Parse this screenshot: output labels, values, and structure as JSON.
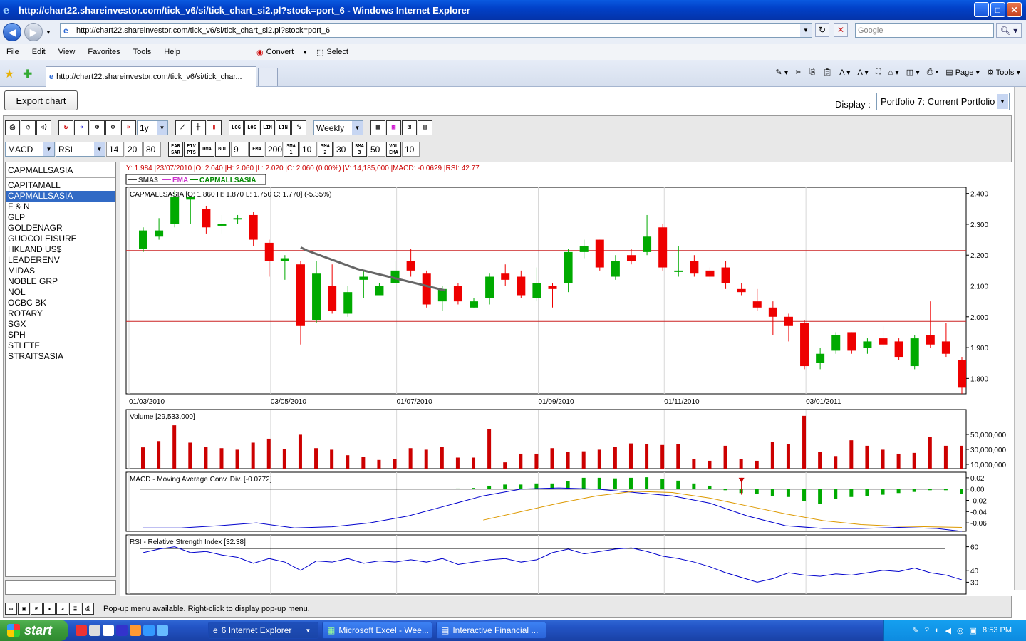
{
  "window": {
    "title": "http://chart22.shareinvestor.com/tick_v6/si/tick_chart_si2.pl?stock=port_6 - Windows Internet Explorer",
    "min": "_",
    "max": "□",
    "close": "✕"
  },
  "address": {
    "url": "http://chart22.shareinvestor.com/tick_v6/si/tick_chart_si2.pl?stock=port_6",
    "search_placeholder": "Google"
  },
  "menu": [
    "File",
    "Edit",
    "View",
    "Favorites",
    "Tools",
    "Help"
  ],
  "toolbar": {
    "convert": "Convert",
    "select": "Select",
    "page": "Page",
    "tools": "Tools"
  },
  "tab": {
    "label": "http://chart22.shareinvestor.com/tick_v6/si/tick_char..."
  },
  "page": {
    "export_label": "Export chart",
    "display_label": "Display :",
    "display_value": "Portfolio 7: Current Portfolio"
  },
  "applet": {
    "period": "1y",
    "interval": "Weekly",
    "ind1": "MACD",
    "ind2": "RSI",
    "row2": {
      "n1": "14",
      "n2": "20",
      "n3": "80",
      "bol": "9",
      "ema": "200",
      "sma1": "10",
      "sma2": "30",
      "sma3": "50",
      "vol": "10"
    },
    "stock_header": "CAPMALLSASIA",
    "stocks": [
      "CAPITAMALL",
      "CAPMALLSASIA",
      "F & N",
      "GLP",
      "GOLDENAGR",
      "GUOCOLEISURE",
      "HKLAND US$",
      "LEADERENV",
      "MIDAS",
      "NOBLE GRP",
      "NOL",
      "OCBC BK",
      "ROTARY",
      "SGX",
      "SPH",
      "STI ETF",
      "STRAITSASIA"
    ],
    "selected_index": 1,
    "status": "Pop-up menu available. Right-click to display pop-up menu."
  },
  "chart_data": {
    "type": "candlestick",
    "info_line": "Y: 1.984 |23/07/2010 |O: 2.040 |H: 2.060 |L: 2.020 |C: 2.060 (0.00%) |V: 14,185,000 |MACD: -0.0629 |RSI: 42.77",
    "legend": [
      "SMA3",
      "EMA",
      "CAPMALLSASIA"
    ],
    "price_label": "CAPMALLSASIA [O: 1.860  H: 1.870  L: 1.750  C: 1.770] (-5.35%)",
    "volume_label": "Volume [29,533,000]",
    "macd_label": "MACD - Moving Average Conv. Div. [-0.0772]",
    "rsi_label": "RSI - Relative Strength Index [32.38]",
    "x_labels": [
      "01/03/2010",
      "03/05/2010",
      "01/07/2010",
      "01/09/2010",
      "01/11/2010",
      "03/01/2011"
    ],
    "ylim": [
      1.75,
      2.42
    ],
    "y_ticks": [
      "2.400",
      "2.300",
      "2.200",
      "2.100",
      "2.000",
      "1.900",
      "1.800"
    ],
    "hlines": [
      2.215,
      1.985
    ],
    "vol_ticks": [
      "50,000,000",
      "30,000,000",
      "10,000,000"
    ],
    "macd_ticks": [
      "0.02",
      "0.00",
      "-0.02",
      "-0.04",
      "-0.06"
    ],
    "rsi_ticks": [
      "60",
      "40",
      "30"
    ],
    "ohlc": [
      [
        2.22,
        2.28,
        2.21,
        2.29
      ],
      [
        2.26,
        2.28,
        2.25,
        2.32
      ],
      [
        2.3,
        2.39,
        2.29,
        2.41
      ],
      [
        2.38,
        2.39,
        2.3,
        2.39
      ],
      [
        2.35,
        2.29,
        2.27,
        2.36
      ],
      [
        2.3,
        2.3,
        2.27,
        2.33
      ],
      [
        2.32,
        2.32,
        2.3,
        2.33
      ],
      [
        2.33,
        2.25,
        2.23,
        2.34
      ],
      [
        2.24,
        2.18,
        2.13,
        2.25
      ],
      [
        2.18,
        2.19,
        2.12,
        2.2
      ],
      [
        2.17,
        1.97,
        1.91,
        2.18
      ],
      [
        1.99,
        2.14,
        1.98,
        2.18
      ],
      [
        2.1,
        2.02,
        2.01,
        2.17
      ],
      [
        2.01,
        2.08,
        2.0,
        2.1
      ],
      [
        2.12,
        2.13,
        2.06,
        2.15
      ],
      [
        2.07,
        2.1,
        2.07,
        2.11
      ],
      [
        2.11,
        2.15,
        2.11,
        2.18
      ],
      [
        2.18,
        2.15,
        2.13,
        2.22
      ],
      [
        2.14,
        2.04,
        2.03,
        2.15
      ],
      [
        2.05,
        2.09,
        2.02,
        2.1
      ],
      [
        2.1,
        2.05,
        2.04,
        2.11
      ],
      [
        2.03,
        2.05,
        2.03,
        2.06
      ],
      [
        2.06,
        2.13,
        2.04,
        2.14
      ],
      [
        2.14,
        2.12,
        2.1,
        2.17
      ],
      [
        2.13,
        2.07,
        2.06,
        2.15
      ],
      [
        2.06,
        2.11,
        2.05,
        2.16
      ],
      [
        2.1,
        2.09,
        2.03,
        2.11
      ],
      [
        2.11,
        2.21,
        2.08,
        2.22
      ],
      [
        2.21,
        2.23,
        2.19,
        2.25
      ],
      [
        2.25,
        2.16,
        2.15,
        2.25
      ],
      [
        2.13,
        2.18,
        2.12,
        2.2
      ],
      [
        2.2,
        2.18,
        2.17,
        2.22
      ],
      [
        2.21,
        2.26,
        2.2,
        2.33
      ],
      [
        2.29,
        2.16,
        2.15,
        2.3
      ],
      [
        2.15,
        2.15,
        2.13,
        2.23
      ],
      [
        2.18,
        2.14,
        2.13,
        2.2
      ],
      [
        2.15,
        2.13,
        2.12,
        2.16
      ],
      [
        2.16,
        2.11,
        2.09,
        2.18
      ],
      [
        2.09,
        2.08,
        2.07,
        2.11
      ],
      [
        2.05,
        2.03,
        2.02,
        2.09
      ],
      [
        2.03,
        2.0,
        1.94,
        2.05
      ],
      [
        2.0,
        1.97,
        1.92,
        2.01
      ],
      [
        1.98,
        1.84,
        1.83,
        1.99
      ],
      [
        1.85,
        1.88,
        1.83,
        1.9
      ],
      [
        1.89,
        1.94,
        1.88,
        1.95
      ],
      [
        1.95,
        1.89,
        1.88,
        1.95
      ],
      [
        1.9,
        1.92,
        1.88,
        1.93
      ],
      [
        1.93,
        1.91,
        1.9,
        1.97
      ],
      [
        1.92,
        1.87,
        1.86,
        1.93
      ],
      [
        1.84,
        1.93,
        1.83,
        1.94
      ],
      [
        1.94,
        1.91,
        1.9,
        2.05
      ],
      [
        1.92,
        1.88,
        1.87,
        1.98
      ],
      [
        1.86,
        1.77,
        1.75,
        1.87
      ]
    ],
    "sma3": [
      [
        39,
        2.225
      ],
      [
        40,
        2.215
      ],
      [
        42,
        2.2
      ],
      [
        44,
        2.185
      ],
      [
        46,
        2.17
      ],
      [
        48,
        2.155
      ],
      [
        50,
        2.145
      ],
      [
        52,
        2.135
      ],
      [
        54,
        2.125
      ],
      [
        56,
        2.115
      ],
      [
        58,
        2.105
      ],
      [
        60,
        2.095
      ],
      [
        62,
        2.085
      ]
    ],
    "volume": [
      27,
      35,
      55,
      33,
      28,
      26,
      24,
      33,
      38,
      25,
      43,
      26,
      24,
      17,
      15,
      11,
      12,
      26,
      24,
      28,
      14,
      14,
      50,
      8,
      19,
      19,
      26,
      21,
      22,
      24,
      28,
      32,
      31,
      30,
      31,
      12,
      10,
      29,
      12,
      10,
      34,
      31,
      67,
      21,
      16,
      36,
      29,
      24,
      19,
      20,
      40,
      29,
      29
    ],
    "vol_max": 75,
    "macd": [
      0,
      0,
      0,
      0,
      0,
      0,
      0,
      0,
      0,
      0,
      0,
      0,
      0,
      0,
      0,
      0,
      0,
      0,
      0,
      0,
      0.001,
      0.002,
      0.006,
      0.008,
      0.008,
      0.01,
      0.01,
      0.014,
      0.02,
      0.02,
      0.019,
      0.02,
      0.021,
      0.018,
      0.015,
      0.01,
      0.006,
      -0.002,
      -0.007,
      -0.008,
      -0.012,
      -0.014,
      -0.021,
      -0.026,
      -0.018,
      -0.014,
      -0.013,
      -0.01,
      -0.007,
      -0.005,
      -0.002,
      -0.002,
      -0.008
    ],
    "macd_range": [
      -0.075,
      0.03
    ],
    "macd_line": [
      [
        14,
        -0.069
      ],
      [
        20,
        -0.069
      ],
      [
        26,
        -0.065
      ],
      [
        32,
        -0.06
      ],
      [
        38,
        -0.069
      ],
      [
        44,
        -0.067
      ],
      [
        50,
        -0.06
      ],
      [
        56,
        -0.048
      ],
      [
        62,
        -0.03
      ],
      [
        68,
        -0.012
      ],
      [
        74,
        0.0
      ],
      [
        80,
        0.002
      ],
      [
        86,
        0.0
      ],
      [
        92,
        -0.006
      ],
      [
        98,
        -0.012
      ],
      [
        104,
        -0.025
      ],
      [
        110,
        -0.048
      ],
      [
        116,
        -0.065
      ],
      [
        122,
        -0.07
      ],
      [
        128,
        -0.07
      ],
      [
        134,
        -0.068
      ],
      [
        140,
        -0.07
      ],
      [
        144,
        -0.075
      ]
    ],
    "signal_line": [
      [
        68,
        -0.055
      ],
      [
        74,
        -0.04
      ],
      [
        80,
        -0.025
      ],
      [
        86,
        -0.012
      ],
      [
        92,
        -0.004
      ],
      [
        98,
        -0.006
      ],
      [
        104,
        -0.016
      ],
      [
        110,
        -0.03
      ],
      [
        116,
        -0.044
      ],
      [
        122,
        -0.056
      ],
      [
        128,
        -0.063
      ],
      [
        134,
        -0.066
      ],
      [
        144,
        -0.068
      ]
    ],
    "rsi": [
      55,
      58,
      60,
      55,
      56,
      53,
      51,
      46,
      50,
      47,
      40,
      48,
      47,
      50,
      46,
      48,
      47,
      49,
      47,
      50,
      45,
      47,
      49,
      50,
      47,
      49,
      55,
      58,
      54,
      56,
      58,
      59,
      56,
      52,
      50,
      47,
      43,
      38,
      34,
      30,
      33,
      38,
      36,
      35,
      37,
      36,
      38,
      40,
      39,
      42,
      38,
      36,
      32
    ],
    "rsi_range": [
      20,
      70
    ]
  }
}
